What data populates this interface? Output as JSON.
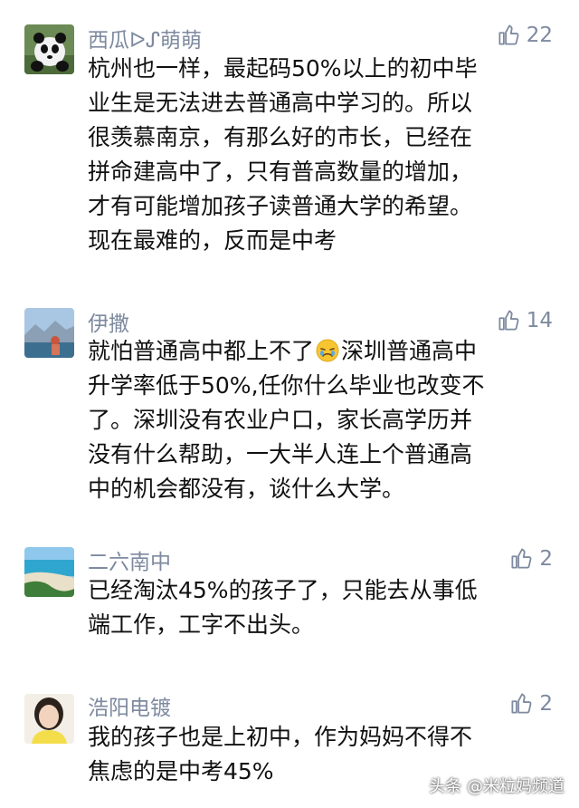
{
  "comments": [
    {
      "username": "西瓜ᐅ⁠ᔑ萌萌",
      "likes": "22",
      "lines": [
        "杭州也一样，最起码50%以上的初中毕",
        "业生是无法进去普通高中学习的。所以",
        "很羡慕南京，有那么好的市长，已经在",
        "拼命建高中了，只有普高数量的增加，",
        "才有可能增加孩子读普通大学的希望。",
        "现在最难的，反而是中考"
      ]
    },
    {
      "username": "伊撒",
      "likes": "14",
      "lines_first_before": "就怕普通高中都上不了",
      "lines_first_after": "深圳普通高中",
      "lines": [
        "升学率低于50%,任你什么毕业也改变不",
        "了。深圳没有农业户口，家长高学历并",
        "没有什么帮助，一大半人连上个普通高",
        "中的机会都没有，谈什么大学。"
      ]
    },
    {
      "username": "二六南中",
      "likes": "2",
      "lines": [
        "已经淘汰45%的孩子了，只能去从事低",
        "端工作，工字不出头。"
      ]
    },
    {
      "username": "浩阳电镀",
      "likes": "2",
      "lines": [
        "我的孩子也是上初中，作为妈妈不得不",
        "焦虑的是中考45%"
      ]
    }
  ],
  "watermark": "头条 @米粒妈频道",
  "icons": {
    "like": "thumbs-up-icon",
    "emoji": "crying-face-emoji-icon"
  },
  "colors": {
    "meta_text": "#7e8a9f",
    "body_text": "#111111"
  }
}
